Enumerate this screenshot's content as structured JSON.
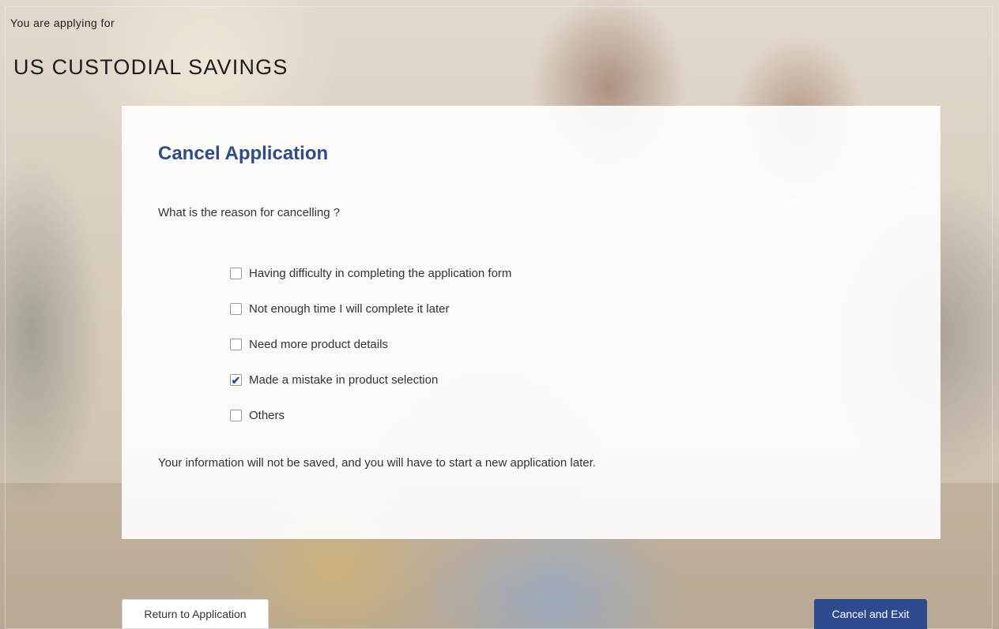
{
  "header": {
    "applying_label": "You are applying for",
    "product_name": "US CUSTODIAL SAVINGS"
  },
  "dialog": {
    "title": "Cancel Application",
    "question": "What is the reason for cancelling ?",
    "reasons": [
      {
        "label": "Having difficulty in completing the application form",
        "checked": false
      },
      {
        "label": "Not enough time I will complete it later",
        "checked": false
      },
      {
        "label": "Need more product details",
        "checked": false
      },
      {
        "label": "Made a mistake in product selection",
        "checked": true
      },
      {
        "label": "Others",
        "checked": false
      }
    ],
    "notice": "Your information will not be saved, and you will have to start a new application later."
  },
  "actions": {
    "return_label": "Return to Application",
    "cancel_exit_label": "Cancel and Exit"
  },
  "colors": {
    "accent": "#2d4b8e",
    "text": "#333333"
  },
  "icons": {
    "checked": "checkmark-icon"
  }
}
